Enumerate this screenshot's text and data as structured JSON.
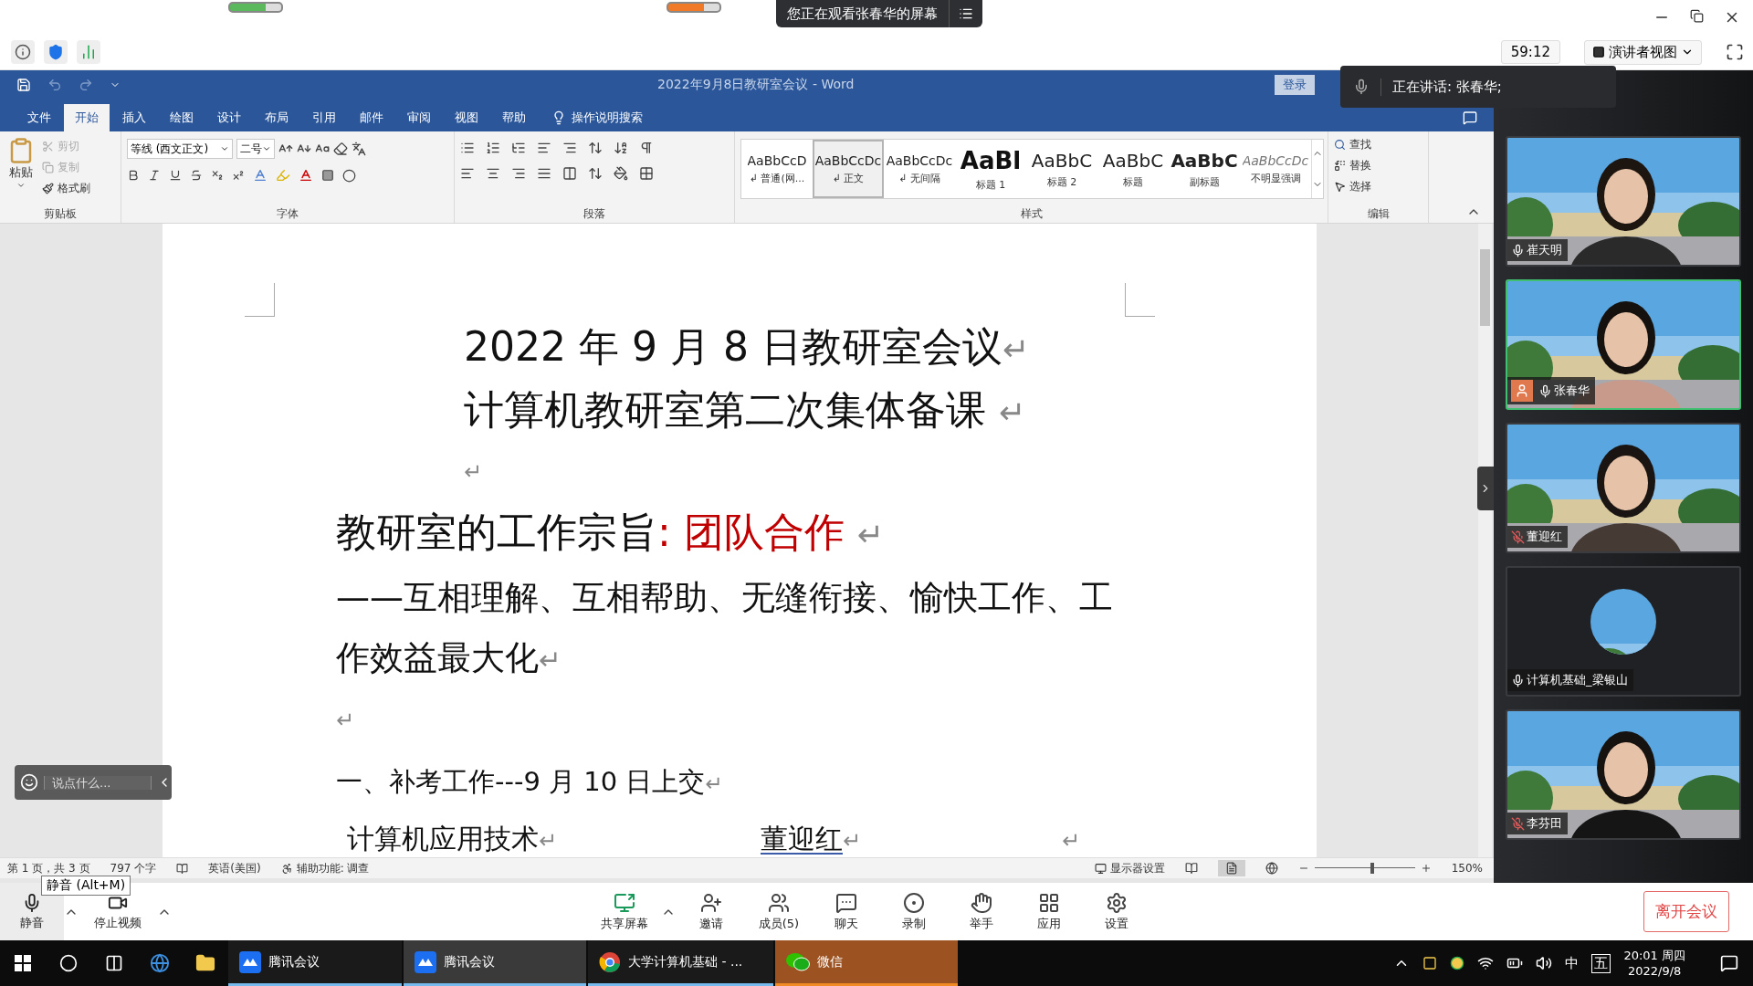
{
  "meeting_bar": {
    "viewing_notice": "您正在观看张春华的屏幕",
    "timer": "59:12",
    "view_mode": "演讲者视图"
  },
  "speaking": "正在讲话: 张春华;",
  "word": {
    "title": "2022年9月8日教研室会议  -  Word",
    "sign_in": "登录",
    "tabs": [
      {
        "label": "文件",
        "selected": false
      },
      {
        "label": "开始",
        "selected": true
      },
      {
        "label": "插入",
        "selected": false
      },
      {
        "label": "绘图",
        "selected": false
      },
      {
        "label": "设计",
        "selected": false
      },
      {
        "label": "布局",
        "selected": false
      },
      {
        "label": "引用",
        "selected": false
      },
      {
        "label": "邮件",
        "selected": false
      },
      {
        "label": "审阅",
        "selected": false
      },
      {
        "label": "视图",
        "selected": false
      },
      {
        "label": "帮助",
        "selected": false
      }
    ],
    "tell_me": "操作说明搜索",
    "clipboard": {
      "paste": "粘贴",
      "label": "剪贴板",
      "items": [
        {
          "label": "剪切",
          "disabled": true
        },
        {
          "label": "复制",
          "disabled": true
        },
        {
          "label": "格式刷",
          "disabled": false
        }
      ]
    },
    "font": {
      "name": "等线 (西文正文)",
      "size": "二号",
      "label": "字体"
    },
    "paragraph": {
      "label": "段落"
    },
    "styles": {
      "label": "样式",
      "items": [
        {
          "kind": "normal",
          "preview": "AaBbCcD",
          "name": "↲ 普通(网...",
          "selected": false
        },
        {
          "kind": "normal",
          "preview": "AaBbCcDc",
          "name": "↲ 正文",
          "selected": true
        },
        {
          "kind": "normal",
          "preview": "AaBbCcDc",
          "name": "↲ 无间隔",
          "selected": false
        },
        {
          "kind": "heading1",
          "preview": "AaBl",
          "name": "标题 1",
          "selected": false
        },
        {
          "kind": "heading2",
          "preview": "AaBbC",
          "name": "标题 2",
          "selected": false
        },
        {
          "kind": "title",
          "preview": "AaBbC",
          "name": "标题",
          "selected": false
        },
        {
          "kind": "subtitle",
          "preview": "AaBbC",
          "name": "副标题",
          "selected": false
        },
        {
          "kind": "subtle",
          "preview": "AaBbCcDc",
          "name": "不明显强调",
          "selected": false
        }
      ]
    },
    "editing": {
      "find": "查找",
      "replace": "替换",
      "select": "选择",
      "label": "编辑"
    },
    "document": [
      {
        "kind": "title",
        "text": "2022 年 9 月 8 日教研室会议",
        "mark": "↵"
      },
      {
        "kind": "title",
        "text": "计算机教研室第二次集体备课 ",
        "mark": "↵"
      },
      {
        "kind": "gap-title",
        "mark": "↵"
      },
      {
        "kind": "heading",
        "text": "教研室的工作宗旨",
        "accent": ":  团队合作 ",
        "mark": "↵"
      },
      {
        "kind": "body",
        "text": "——互相理解、互相帮助、无缝衔接、愉快工作、工作效益最大化",
        "mark": "↵"
      },
      {
        "kind": "gap",
        "mark": "↵"
      },
      {
        "kind": "item",
        "text": "一、补考工作---9 月 10 日上交",
        "mark": "↵"
      },
      {
        "kind": "row",
        "cells": [
          {
            "text": "计算机应用技术",
            "mark": "↵",
            "underlined": false
          },
          {
            "text": "董迎红",
            "mark": "↵",
            "underlined": true
          },
          {
            "mark": "↵"
          }
        ]
      }
    ],
    "status_bar": {
      "page": "第 1 页，共 3 页",
      "words": "797 个字",
      "language": "英语(美国)",
      "accessibility": "辅助功能: 调查",
      "display_settings": "显示器设置",
      "zoom": "150%",
      "zoom_slider": {
        "level": 0.56
      }
    }
  },
  "participants": [
    {
      "name": "崔天明",
      "muted": false,
      "video": true,
      "active": false
    },
    {
      "name": "张春华",
      "muted": false,
      "video": true,
      "active": true
    },
    {
      "name": "董迎红",
      "muted": true,
      "video": true,
      "active": false
    },
    {
      "name": "计算机基础_梁银山",
      "muted": false,
      "video": false,
      "active": false
    },
    {
      "name": "李芬田",
      "muted": true,
      "video": true,
      "active": false
    }
  ],
  "chat_box": {
    "placeholder": "说点什么..."
  },
  "left_controls": [
    {
      "label": "静音"
    },
    {
      "label": "停止视频"
    }
  ],
  "tooltip": "静音 (Alt+M)",
  "center_controls": [
    {
      "label": "共享屏幕"
    },
    {
      "label": "邀请"
    },
    {
      "label": "成员(5)"
    },
    {
      "label": "聊天"
    },
    {
      "label": "录制"
    },
    {
      "label": "举手"
    },
    {
      "label": "应用"
    },
    {
      "label": "设置"
    }
  ],
  "leave": "离开会议",
  "taskbar": {
    "apps": [
      {
        "kind": "meeting",
        "label": "腾讯会议",
        "active": false
      },
      {
        "kind": "meeting",
        "label": "腾讯会议",
        "active": true
      },
      {
        "kind": "browser",
        "label": "大学计算机基础 - ...",
        "active": false
      },
      {
        "kind": "chat",
        "label": "微信",
        "active": false,
        "flashing": true
      }
    ],
    "ime": "中",
    "ime_mode": "五",
    "time": "20:01 周四",
    "date": "2022/9/8"
  }
}
